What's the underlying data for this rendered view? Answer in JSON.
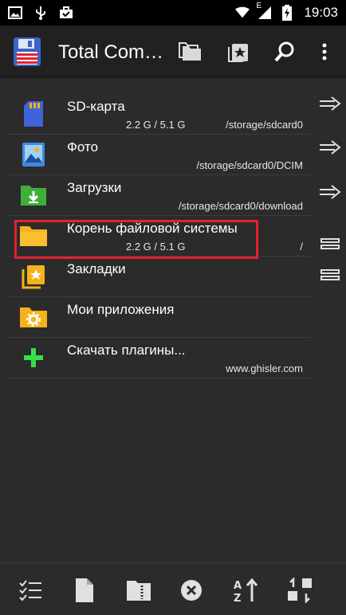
{
  "status_bar": {
    "time": "19:03",
    "network_badge": "E",
    "icons": [
      "image-icon",
      "usb-icon",
      "briefcase-check-icon",
      "wifi-icon",
      "signal-icon",
      "battery-charging-icon"
    ]
  },
  "app_bar": {
    "title": "Total Com…",
    "icons": [
      "total-commander-logo-icon",
      "folders-icon",
      "bookmark-folder-icon",
      "search-icon",
      "more-vert-icon"
    ]
  },
  "items": [
    {
      "label": "SD-карта",
      "size": "2.2 G / 5.1 G",
      "path": "/storage/sdcard0",
      "icon": "sd-card-icon"
    },
    {
      "label": "Фото",
      "size": "",
      "path": "/storage/sdcard0/DCIM",
      "icon": "photo-icon"
    },
    {
      "label": "Загрузки",
      "size": "",
      "path": "/storage/sdcard0/download",
      "icon": "download-folder-icon"
    },
    {
      "label": "Корень файловой системы",
      "size": "2.2 G / 5.1 G",
      "path": "/",
      "icon": "folder-icon"
    },
    {
      "label": "Закладки",
      "size": "",
      "path": "",
      "icon": "bookmarks-icon"
    },
    {
      "label": "Мои приложения",
      "size": "",
      "path": "",
      "icon": "apps-folder-icon"
    },
    {
      "label": "Скачать плагины...",
      "size": "",
      "path": "www.ghisler.com",
      "icon": "plus-icon"
    }
  ],
  "side_buttons": [
    "arrow-right-icon",
    "arrow-right-icon",
    "arrow-right-icon",
    "equals-icon",
    "equals-icon"
  ],
  "bottom_toolbar": [
    "select-list-icon",
    "new-file-icon",
    "archive-icon",
    "delete-icon",
    "sort-icon",
    "swap-icon"
  ],
  "colors": {
    "accent_highlight": "#e5202e",
    "folder": "#f6b21b",
    "background": "#2b2b2b",
    "toolbar": "#212121"
  }
}
